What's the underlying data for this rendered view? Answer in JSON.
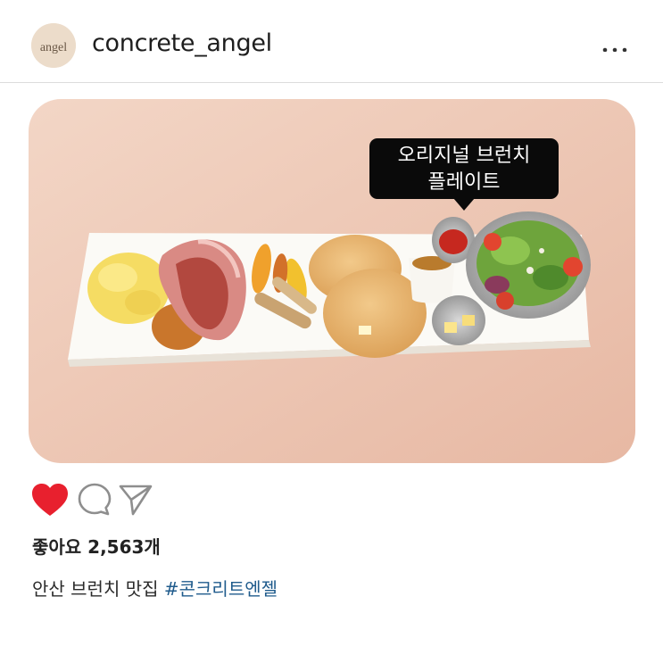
{
  "header": {
    "avatar_text": "angel",
    "username": "concrete_angel"
  },
  "photo": {
    "label_line1": "오리지널 브런치",
    "label_line2": "플레이트"
  },
  "actions": {
    "like_icon": "heart-filled-icon",
    "comment_icon": "comment-icon",
    "share_icon": "send-icon",
    "like_color": "#e8202e"
  },
  "likes": {
    "text": "좋아요 2,563개"
  },
  "caption": {
    "text": "안산 브런치 맛집 ",
    "hashtag": "#콘크리트엔젤"
  },
  "colors": {
    "background_peach": "#efcbb8",
    "hashtag": "#1f5b8c"
  }
}
